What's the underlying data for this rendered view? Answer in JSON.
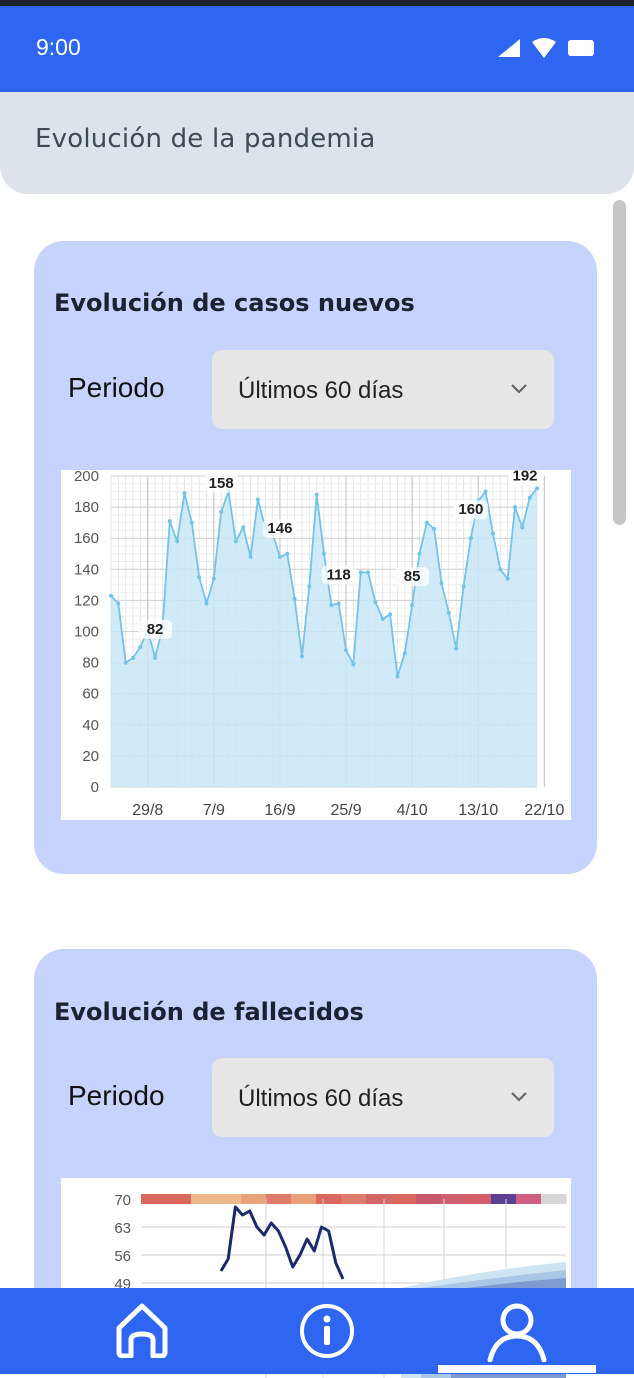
{
  "status_bar": {
    "time": "9:00",
    "icons": [
      "signal-icon",
      "wifi-icon",
      "battery-icon"
    ]
  },
  "app_bar": {
    "title": "Evolución de la pandemia"
  },
  "cards": [
    {
      "title": "Evolución de casos nuevos",
      "period_label": "Periodo",
      "period_value": "Últimos 60 días"
    },
    {
      "title": "Evolución de fallecidos",
      "period_label": "Periodo",
      "period_value": "Últimos 60 días"
    }
  ],
  "chart_data": [
    {
      "type": "area",
      "ylim": [
        0,
        200
      ],
      "yticks": [
        "0",
        "20",
        "40",
        "60",
        "80",
        "100",
        "120",
        "140",
        "160",
        "180",
        "200"
      ],
      "xtick_labels": [
        "29/8",
        "7/9",
        "16/9",
        "25/9",
        "4/10",
        "13/10",
        "22/10"
      ],
      "xtick_index": [
        6,
        15,
        24,
        33,
        42,
        51,
        60
      ],
      "values": [
        123,
        118,
        80,
        83,
        90,
        101,
        83,
        102,
        171,
        158,
        189,
        170,
        135,
        118,
        134,
        177,
        190,
        158,
        167,
        148,
        185,
        167,
        163,
        148,
        150,
        121,
        84,
        129,
        188,
        150,
        117,
        118,
        88,
        79,
        138,
        138,
        119,
        108,
        111,
        71,
        86,
        117,
        150,
        170,
        166,
        131,
        112,
        89,
        129,
        160,
        184,
        190,
        163,
        140,
        134,
        180,
        167,
        186,
        192
      ],
      "point_labels": [
        {
          "index": 6,
          "text": "82"
        },
        {
          "index": 15,
          "text": "158"
        },
        {
          "index": 23,
          "text": "146"
        },
        {
          "index": 31,
          "text": "118"
        },
        {
          "index": 41,
          "text": "85"
        },
        {
          "index": 49,
          "text": "160"
        },
        {
          "index": 58,
          "text": "192"
        }
      ],
      "line_color": "#74c3e8",
      "fill_color": "#c8e6f6"
    },
    {
      "type": "line",
      "yticks": [
        "70",
        "63",
        "56",
        "49"
      ],
      "series": [
        {
          "values": [
            52,
            55,
            68,
            66,
            67,
            63,
            61,
            64,
            62,
            58,
            53,
            56,
            60,
            57,
            63,
            62,
            54,
            50
          ]
        }
      ],
      "line_color": "#1a2a6b"
    }
  ],
  "nav": {
    "items": [
      "home-icon",
      "info-icon",
      "person-icon"
    ]
  }
}
